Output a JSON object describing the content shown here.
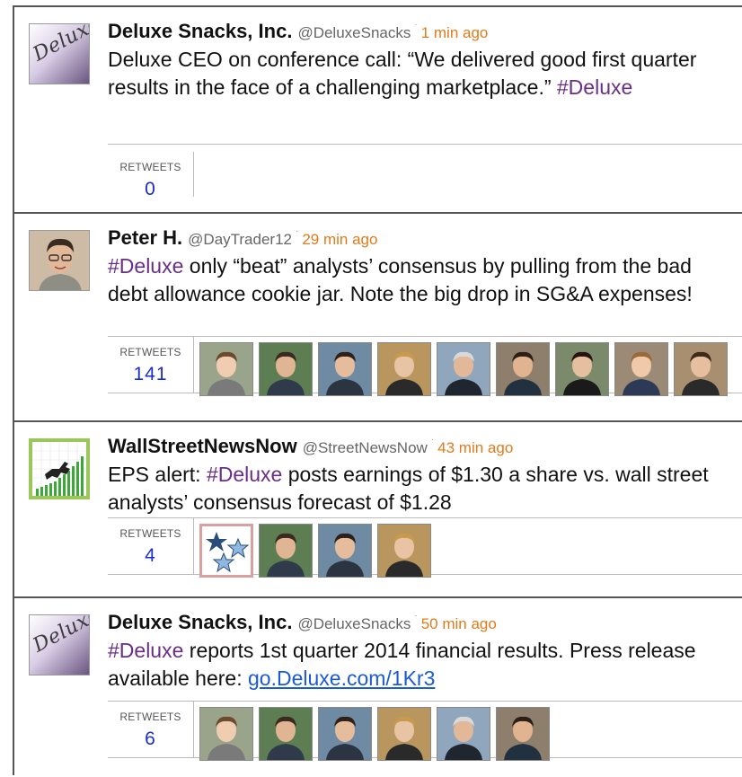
{
  "tweets": [
    {
      "name": "Deluxe Snacks, Inc.",
      "handle": "@DeluxeSnacks",
      "separator": "·",
      "time": "1 min ago",
      "avatar_logo_text": "Deluxe",
      "text_parts": [
        "Deluxe CEO on conference call: “We delivered good first quarter results in the face of a challenging marketplace.” ",
        "#Deluxe"
      ],
      "retweets_label": "RETWEETS",
      "retweets_count": "0"
    },
    {
      "name": "Peter H.",
      "handle": "@DayTrader12",
      "separator": "·",
      "time": "29 min ago",
      "text_parts": [
        "#Deluxe",
        " only “beat” analysts’ consensus by pulling from the bad debt allowance cookie jar. Note the big drop in SG&A expenses!"
      ],
      "retweets_label": "RETWEETS",
      "retweets_count": "141"
    },
    {
      "name": "WallStreetNewsNow",
      "handle": "@StreetNewsNow",
      "separator": "·",
      "time": "43 min ago",
      "text_parts": [
        "EPS alert: ",
        "#Deluxe",
        " posts earnings of $1.30 a share vs. wall street analysts’ consensus forecast of $1.28"
      ],
      "retweets_label": "RETWEETS",
      "retweets_count": "4"
    },
    {
      "name": "Deluxe Snacks, Inc.",
      "handle": "@DeluxeSnacks",
      "separator": "·",
      "time": "50 min ago",
      "avatar_logo_text": "Deluxe",
      "text_parts": [
        "#Deluxe",
        " reports 1st quarter 2014 financial results. Press release available here: ",
        "go.Deluxe.com/1Kr3"
      ],
      "retweets_label": "RETWEETS",
      "retweets_count": "6"
    }
  ],
  "colors": {
    "hashtag": "#6a2e84",
    "time": "#e07b1c",
    "retweet_count": "#1a2ec8",
    "link": "#1a5ad8"
  },
  "icons": [
    "retweeter-avatar",
    "stars-icon",
    "bull-chart-icon"
  ]
}
